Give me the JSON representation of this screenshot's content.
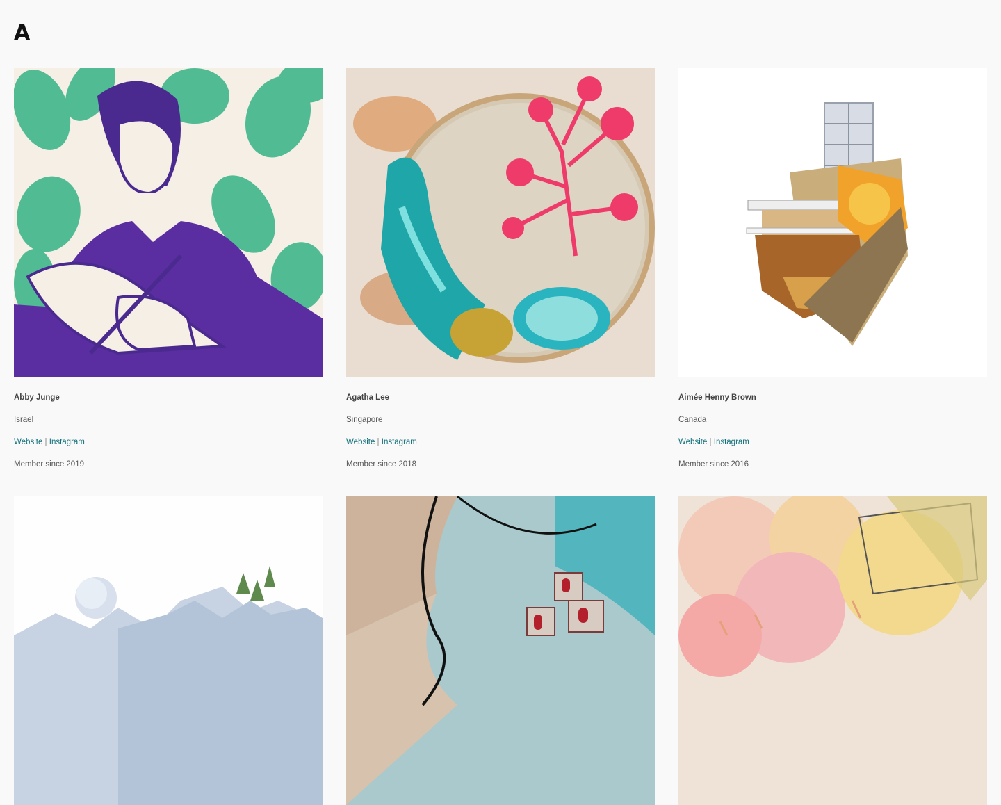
{
  "section": {
    "letter": "A"
  },
  "artists": [
    {
      "name": "Abby Junge",
      "country": "Israel",
      "website_label": "Website",
      "separator": "|",
      "instagram_label": "Instagram",
      "member_since": "Member since 2019"
    },
    {
      "name": "Agatha Lee",
      "country": "Singapore",
      "website_label": "Website",
      "separator": "|",
      "instagram_label": "Instagram",
      "member_since": "Member since 2018"
    },
    {
      "name": "Aimée Henny Brown",
      "country": "Canada",
      "website_label": "Website",
      "separator": "|",
      "instagram_label": "Instagram",
      "member_since": "Member since 2016"
    }
  ],
  "colors": {
    "link": "#0f6f7a",
    "background": "#f9f9f9"
  }
}
